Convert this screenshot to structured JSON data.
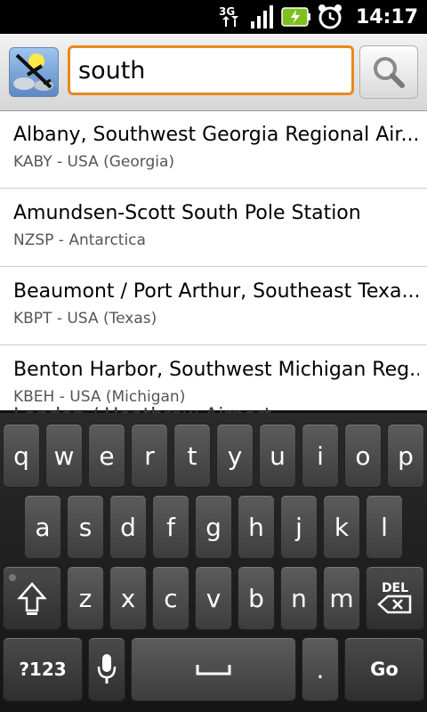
{
  "status_bar": {
    "network": "3G",
    "time": "14:17",
    "icons": [
      "3g-data-icon",
      "signal-bars-icon",
      "battery-charging-icon",
      "alarm-clock-icon"
    ]
  },
  "search": {
    "query": "south",
    "app_icon": "airplane-weather-icon",
    "button_icon": "magnifier-icon"
  },
  "results": [
    {
      "title": "Albany, Southwest Georgia Regional Air...",
      "subtitle": "KABY - USA (Georgia)"
    },
    {
      "title": "Amundsen-Scott South Pole Station",
      "subtitle": "NZSP - Antarctica"
    },
    {
      "title": "Beaumont / Port Arthur, Southeast Texa...",
      "subtitle": "KBPT - USA (Texas)"
    },
    {
      "title": "Benton Harbor, Southwest Michigan Reg...",
      "subtitle": "KBEH - USA (Michigan)"
    }
  ],
  "behind_text": "London / Heathrow Airport",
  "keyboard": {
    "row1": [
      "q",
      "w",
      "e",
      "r",
      "t",
      "y",
      "u",
      "i",
      "o",
      "p"
    ],
    "row2": [
      "a",
      "s",
      "d",
      "f",
      "g",
      "h",
      "j",
      "k",
      "l"
    ],
    "row3": [
      "z",
      "x",
      "c",
      "v",
      "b",
      "n",
      "m"
    ],
    "symbols_label": "?123",
    "period": ".",
    "go_label": "Go",
    "delete_label": "DEL"
  },
  "colors": {
    "accent_orange": "#e8891c",
    "keyboard_bg": "#1e1e1e",
    "key_face": "#4e4e4e"
  }
}
